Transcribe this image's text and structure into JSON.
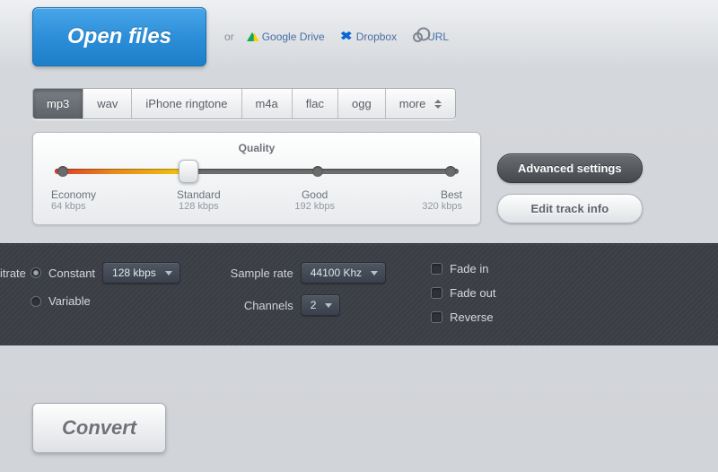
{
  "open": {
    "button": "Open files",
    "or": "or",
    "gdrive": "Google Drive",
    "dropbox": "Dropbox",
    "url": "URL"
  },
  "formats": {
    "items": [
      "mp3",
      "wav",
      "iPhone ringtone",
      "m4a",
      "flac",
      "ogg"
    ],
    "more": "more",
    "active_index": 0
  },
  "quality": {
    "title": "Quality",
    "stops": [
      {
        "name": "Economy",
        "rate": "64 kbps"
      },
      {
        "name": "Standard",
        "rate": "128 kbps"
      },
      {
        "name": "Good",
        "rate": "192 kbps"
      },
      {
        "name": "Best",
        "rate": "320 kbps"
      }
    ],
    "selected_index": 1
  },
  "side": {
    "advanced": "Advanced settings",
    "edit_info": "Edit track info"
  },
  "advanced": {
    "bitrate_label": "itrate",
    "constant": "Constant",
    "variable": "Variable",
    "bitrate_value": "128 kbps",
    "sample_rate_label": "Sample rate",
    "sample_rate_value": "44100 Khz",
    "channels_label": "Channels",
    "channels_value": "2",
    "fade_in": "Fade in",
    "fade_out": "Fade out",
    "reverse": "Reverse",
    "bitrate_mode": "constant"
  },
  "convert": {
    "label": "Convert"
  }
}
